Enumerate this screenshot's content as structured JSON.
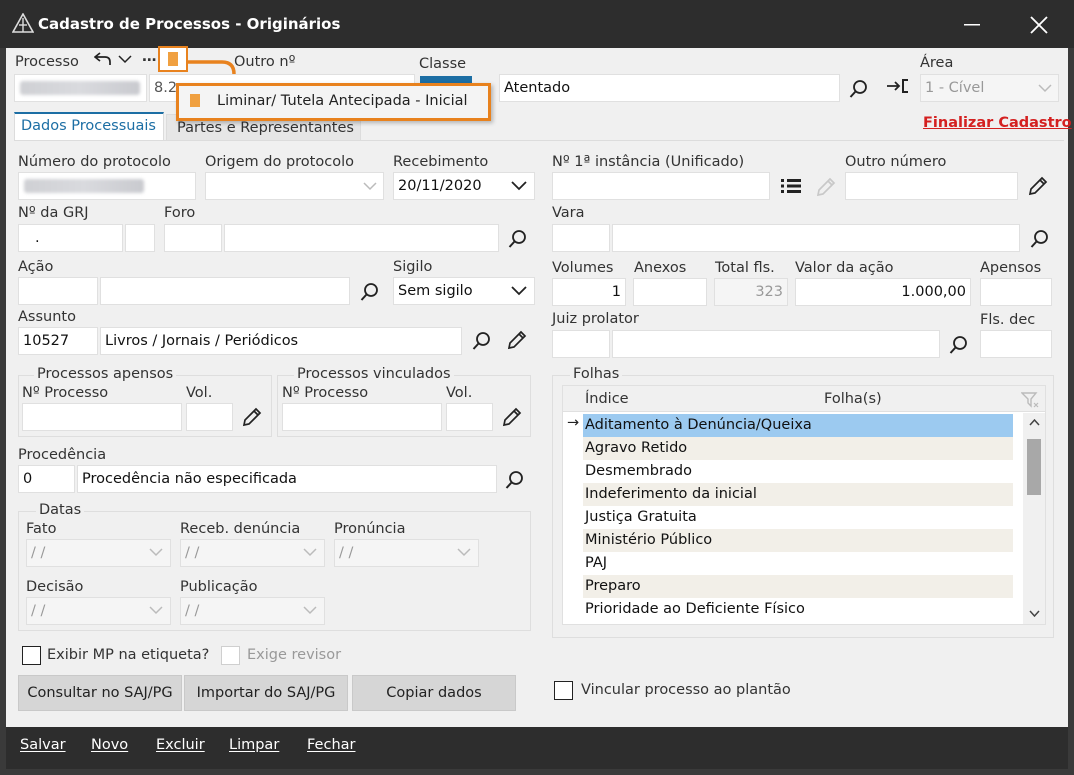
{
  "window": {
    "title": "Cadastro de Processos - Originários"
  },
  "header": {
    "processo_label": "Processo",
    "processo_value_partial": "8.2",
    "outro_no_label": "Outro nº",
    "classe_label": "Classe",
    "classe_value": "Atentado",
    "area_label": "Área",
    "area_value": "1 - Cível",
    "popup_item": "Liminar/ Tutela Antecipada - Inicial",
    "finalizar_link": "Finalizar Cadastro"
  },
  "tabs": [
    {
      "label": "Dados Processuais"
    },
    {
      "label": "Partes e Representantes"
    }
  ],
  "left": {
    "numero_protocolo_label": "Número do protocolo",
    "origem_protocolo_label": "Origem do protocolo",
    "recebimento_label": "Recebimento",
    "recebimento_value": "20/11/2020",
    "grj_label": "Nº da GRJ",
    "grj_value": ".",
    "foro_label": "Foro",
    "acao_label": "Ação",
    "sigilo_label": "Sigilo",
    "sigilo_value": "Sem sigilo",
    "assunto_label": "Assunto",
    "assunto_code": "10527",
    "assunto_desc": "Livros / Jornais / Periódicos",
    "apensos_group": "Processos apensos",
    "vinculados_group": "Processos vinculados",
    "no_processo_label": "Nº Processo",
    "vol_label": "Vol.",
    "procedencia_label": "Procedência",
    "procedencia_code": "0",
    "procedencia_desc": "Procedência não especificada",
    "datas_group": "Datas",
    "fato_label": "Fato",
    "receb_denuncia_label": "Receb. denúncia",
    "pronuncia_label": "Pronúncia",
    "decisao_label": "Decisão",
    "publicacao_label": "Publicação",
    "date_placeholder": " / /",
    "exibir_mp_label": "Exibir MP na etiqueta?",
    "exige_revisor_label": "Exige revisor",
    "consultar_button": "Consultar no SAJ/PG",
    "importar_button": "Importar do SAJ/PG",
    "copiar_button": "Copiar dados"
  },
  "right": {
    "primeira_instancia_label": "Nº 1ª instância (Unificado)",
    "outro_numero_label": "Outro número",
    "vara_label": "Vara",
    "volumes_label": "Volumes",
    "volumes_value": "1",
    "anexos_label": "Anexos",
    "total_fls_label": "Total fls.",
    "total_fls_value": "323",
    "valor_acao_label": "Valor da ação",
    "valor_acao_value": "1.000,00",
    "apensos_label": "Apensos",
    "juiz_label": "Juiz prolator",
    "fls_dec_label": "Fls. dec",
    "folhas_group": "Folhas",
    "col_indice": "Índice",
    "col_folhas": "Folha(s)",
    "folhas_items": [
      "Aditamento à Denúncia/Queixa",
      "Agravo Retido",
      "Desmembrado",
      "Indeferimento da inicial",
      "Justiça Gratuita",
      "Ministério Público",
      "PAJ",
      "Preparo",
      "Prioridade ao Deficiente Físico"
    ],
    "vincular_label": "Vincular processo ao plantão"
  },
  "bottom_bar": {
    "salvar": "Salvar",
    "novo": "Novo",
    "excluir": "Excluir",
    "limpar": "Limpar",
    "fechar": "Fechar"
  },
  "colors": {
    "title_bar": "#2d2d2d",
    "window_bg": "#f0f0f0",
    "accent_orange": "#e8821e",
    "link_red": "#d42020",
    "selection_blue": "#9ccaf0",
    "tab_blue": "#1c6ea4"
  }
}
